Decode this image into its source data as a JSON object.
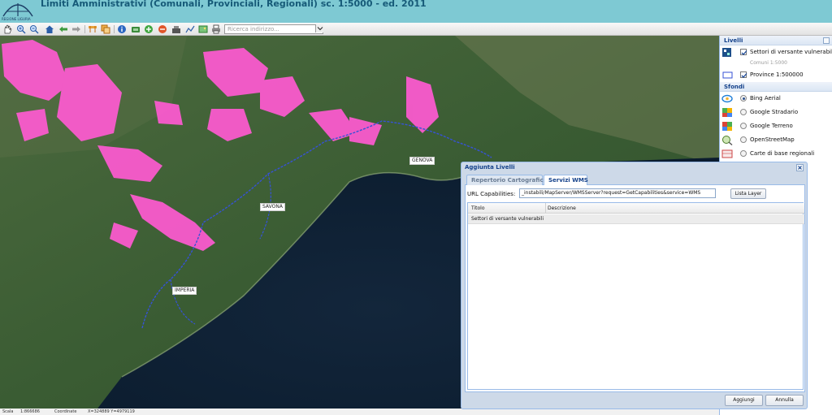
{
  "header": {
    "title": "Limiti Amministrativi (Comunali, Provinciali, Regionali) sc. 1:5000 - ed. 2011",
    "logo_caption": "REGIONE LIGURIA"
  },
  "toolbar": {
    "icons": [
      "pan-hand-icon",
      "zoom-in-icon",
      "zoom-out-icon",
      "home-icon",
      "back-arrow-icon",
      "forward-arrow-icon",
      "measure-icon",
      "layers-icon",
      "info-icon",
      "print-preview-icon",
      "add-layer-icon",
      "remove-layer-icon",
      "tools-icon",
      "graph-icon",
      "image-icon",
      "printer-icon"
    ],
    "search_placeholder": "Ricerca indirizzo..."
  },
  "map": {
    "cities": [
      "GENOVA",
      "SAVONA",
      "IMPERIA"
    ],
    "colors": {
      "vulnerable_sectors": "#ff5ad2",
      "province_border": "#3652d6",
      "sea": "#0e2236",
      "land": "#3f6136"
    }
  },
  "status": {
    "scale_label": "Scala",
    "scale_value": "1:866686",
    "coord_label": "Coordinate",
    "coord_value": "X=324889 Y=4979119"
  },
  "panel": {
    "layers_title": "Livelli",
    "layers": [
      {
        "label": "Settori di versante vulnerabili",
        "checked": true,
        "icon": "wms-layer-icon"
      },
      {
        "label": "Comuni 1:5000",
        "disabled": true
      },
      {
        "label": "Province 1:500000",
        "checked": true,
        "icon": "polygon-layer-icon"
      }
    ],
    "backgrounds_title": "Sfondi",
    "backgrounds": [
      {
        "label": "Bing Aerial",
        "selected": true,
        "icon": "bing-icon"
      },
      {
        "label": "Google Stradario",
        "selected": false,
        "icon": "google-maps-icon"
      },
      {
        "label": "Google Terreno",
        "selected": false,
        "icon": "google-terrain-icon"
      },
      {
        "label": "OpenStreetMap",
        "selected": false,
        "icon": "osm-icon"
      },
      {
        "label": "Carte di base regionali",
        "selected": false,
        "icon": "regional-map-icon"
      }
    ]
  },
  "dialog": {
    "title": "Aggiunta Livelli",
    "tabs": [
      "Repertorio Cartografico",
      "Servizi WMS"
    ],
    "active_tab": "Servizi WMS",
    "url_label": "URL Capabilities:",
    "url_value": "_instabili/MapServer/WMSServer?request=GetCapabilities&service=WMS",
    "list_button": "Lista Layer",
    "columns": [
      "Titolo",
      "Descrizione"
    ],
    "rows": [
      {
        "title": "Settori di versante vulnerabili",
        "description": ""
      }
    ],
    "add_button": "Aggiungi",
    "cancel_button": "Annulla"
  }
}
